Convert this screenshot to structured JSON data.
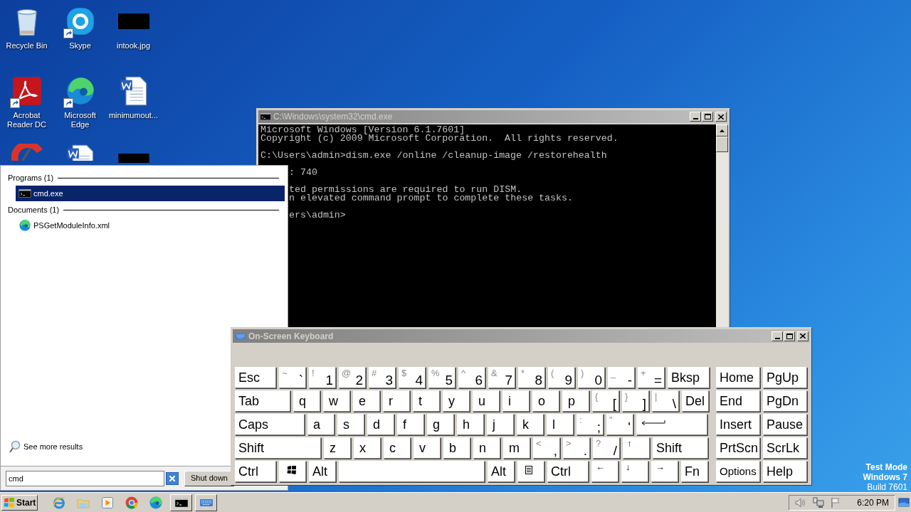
{
  "desktop": {
    "icons": [
      {
        "label": "Recycle Bin",
        "kind": "recycle",
        "shortcut": false
      },
      {
        "label": "Skype",
        "kind": "skype",
        "shortcut": true
      },
      {
        "label": "intook.jpg",
        "kind": "image",
        "shortcut": false
      },
      {
        "label": "Acrobat Reader DC",
        "kind": "acrobat",
        "shortcut": true
      },
      {
        "label": "Microsoft Edge",
        "kind": "edge",
        "shortcut": true
      },
      {
        "label": "minimumout...",
        "kind": "word",
        "shortcut": false
      },
      {
        "kind": "ccleaner"
      },
      {
        "kind": "word"
      },
      {
        "kind": "image"
      }
    ],
    "test_mode": [
      {
        "text": "Test Mode",
        "bold": true
      },
      {
        "text": "Windows 7",
        "bold": true
      },
      {
        "text": "Build 7601",
        "bold": false
      }
    ]
  },
  "cmd_window": {
    "title": "C:\\Windows\\system32\\cmd.exe",
    "lines": [
      {
        "text": "Microsoft Windows [Version 6.1.7601]",
        "blank_before": false,
        "clipped": false
      },
      {
        "text": "Copyright (c) 2009 Microsoft Corporation.  All rights reserved.",
        "blank_before": false,
        "clipped": false
      },
      {
        "text": "C:\\Users\\admin>dism.exe /online /cleanup-image /restorehealth",
        "blank_before": true,
        "clipped": false
      },
      {
        "text": ": 740",
        "blank_before": true,
        "clipped": true
      },
      {
        "text": "ted permissions are required to run DISM.",
        "blank_before": true,
        "clipped": true
      },
      {
        "text": "n elevated command prompt to complete these tasks.",
        "blank_before": false,
        "clipped": true
      },
      {
        "text": "ers\\admin>",
        "blank_before": true,
        "clipped": true
      }
    ]
  },
  "start_menu": {
    "groups": [
      {
        "title": "Programs (1)",
        "items": [
          {
            "label": "cmd.exe",
            "kind": "console",
            "selected": true
          }
        ]
      },
      {
        "title": "Documents (1)",
        "items": [
          {
            "label": "PSGetModuleInfo.xml",
            "kind": "edge",
            "selected": false
          }
        ]
      }
    ],
    "see_more": "See more results",
    "search": {
      "value": "cmd"
    },
    "shutdown": "Shut down"
  },
  "keyboard": {
    "title": "On-Screen Keyboard",
    "rows": [
      {
        "keys": [
          {
            "kind": "word",
            "label": "Esc"
          },
          {
            "kind": "pair",
            "shift": "~",
            "label": "`"
          },
          {
            "kind": "pair",
            "shift": "!",
            "label": "1"
          },
          {
            "kind": "pair",
            "shift": "@",
            "label": "2"
          },
          {
            "kind": "pair",
            "shift": "#",
            "label": "3"
          },
          {
            "kind": "pair",
            "shift": "$",
            "label": "4"
          },
          {
            "kind": "pair",
            "shift": "%",
            "label": "5"
          },
          {
            "kind": "pair",
            "shift": "^",
            "label": "6"
          },
          {
            "kind": "pair",
            "shift": "&",
            "label": "7"
          },
          {
            "kind": "pair",
            "shift": "*",
            "label": "8"
          },
          {
            "kind": "pair",
            "shift": "(",
            "label": "9"
          },
          {
            "kind": "pair",
            "shift": ")",
            "label": "0"
          },
          {
            "kind": "pair",
            "shift": "_",
            "label": "-"
          },
          {
            "kind": "pair",
            "shift": "+",
            "label": "="
          },
          {
            "kind": "word",
            "label": "Bksp"
          }
        ]
      },
      {
        "keys": [
          {
            "kind": "word",
            "label": "Tab"
          },
          {
            "kind": "letter",
            "label": "q"
          },
          {
            "kind": "letter",
            "label": "w"
          },
          {
            "kind": "letter",
            "label": "e"
          },
          {
            "kind": "letter",
            "label": "r"
          },
          {
            "kind": "letter",
            "label": "t"
          },
          {
            "kind": "letter",
            "label": "y"
          },
          {
            "kind": "letter",
            "label": "u"
          },
          {
            "kind": "letter",
            "label": "i"
          },
          {
            "kind": "letter",
            "label": "o"
          },
          {
            "kind": "letter",
            "label": "p"
          },
          {
            "kind": "pair",
            "shift": "{",
            "label": "["
          },
          {
            "kind": "pair",
            "shift": "}",
            "label": "]"
          },
          {
            "kind": "pair",
            "shift": "|",
            "label": "\\"
          },
          {
            "kind": "word",
            "label": "Del"
          }
        ]
      },
      {
        "keys": [
          {
            "kind": "word",
            "label": "Caps"
          },
          {
            "kind": "letter",
            "label": "a"
          },
          {
            "kind": "letter",
            "label": "s"
          },
          {
            "kind": "letter",
            "label": "d"
          },
          {
            "kind": "letter",
            "label": "f"
          },
          {
            "kind": "letter",
            "label": "g"
          },
          {
            "kind": "letter",
            "label": "h"
          },
          {
            "kind": "letter",
            "label": "j"
          },
          {
            "kind": "letter",
            "label": "k"
          },
          {
            "kind": "letter",
            "label": "l"
          },
          {
            "kind": "pair",
            "shift": ":",
            "label": ";"
          },
          {
            "kind": "pair",
            "shift": "\"",
            "label": "'"
          },
          {
            "kind": "enter"
          }
        ]
      },
      {
        "keys": [
          {
            "kind": "word",
            "label": "Shift"
          },
          {
            "kind": "letter",
            "label": "z"
          },
          {
            "kind": "letter",
            "label": "x"
          },
          {
            "kind": "letter",
            "label": "c"
          },
          {
            "kind": "letter",
            "label": "v"
          },
          {
            "kind": "letter",
            "label": "b"
          },
          {
            "kind": "letter",
            "label": "n"
          },
          {
            "kind": "letter",
            "label": "m"
          },
          {
            "kind": "pair",
            "shift": "<",
            "label": ","
          },
          {
            "kind": "pair",
            "shift": ">",
            "label": "."
          },
          {
            "kind": "pair",
            "shift": "?",
            "label": "/"
          },
          {
            "kind": "arrow",
            "label": "↑"
          },
          {
            "kind": "word",
            "label": "Shift"
          }
        ]
      },
      {
        "keys": [
          {
            "kind": "word",
            "label": "Ctrl"
          },
          {
            "kind": "windows"
          },
          {
            "kind": "word",
            "label": "Alt"
          },
          {
            "kind": "space"
          },
          {
            "kind": "word",
            "label": "Alt"
          },
          {
            "kind": "menu"
          },
          {
            "kind": "word",
            "label": "Ctrl"
          },
          {
            "kind": "arrow",
            "label": "←"
          },
          {
            "kind": "arrow",
            "label": "↓"
          },
          {
            "kind": "arrow",
            "label": "→"
          },
          {
            "kind": "word",
            "label": "Fn"
          }
        ]
      }
    ],
    "nav": [
      {
        "keys": [
          {
            "kind": "word",
            "label": "Home"
          },
          {
            "kind": "word",
            "label": "PgUp"
          }
        ]
      },
      {
        "keys": [
          {
            "kind": "word",
            "label": "End"
          },
          {
            "kind": "word",
            "label": "PgDn"
          }
        ]
      },
      {
        "keys": [
          {
            "kind": "word",
            "label": "Insert"
          },
          {
            "kind": "word",
            "label": "Pause"
          }
        ]
      },
      {
        "keys": [
          {
            "kind": "word",
            "label": "PrtScn"
          },
          {
            "kind": "word",
            "label": "ScrLk"
          }
        ]
      },
      {
        "keys": [
          {
            "kind": "small",
            "label": "Options"
          },
          {
            "kind": "word",
            "label": "Help"
          }
        ]
      }
    ]
  },
  "taskbar": {
    "start": "Start",
    "apps": [
      {
        "kind": "ie",
        "open": false
      },
      {
        "kind": "explorer",
        "open": false
      },
      {
        "kind": "media",
        "open": false
      },
      {
        "kind": "chrome",
        "open": false
      },
      {
        "kind": "edge",
        "open": false
      },
      {
        "kind": "console",
        "open": true
      },
      {
        "kind": "keyboard",
        "open": true
      }
    ],
    "clock": "6:20 PM"
  }
}
